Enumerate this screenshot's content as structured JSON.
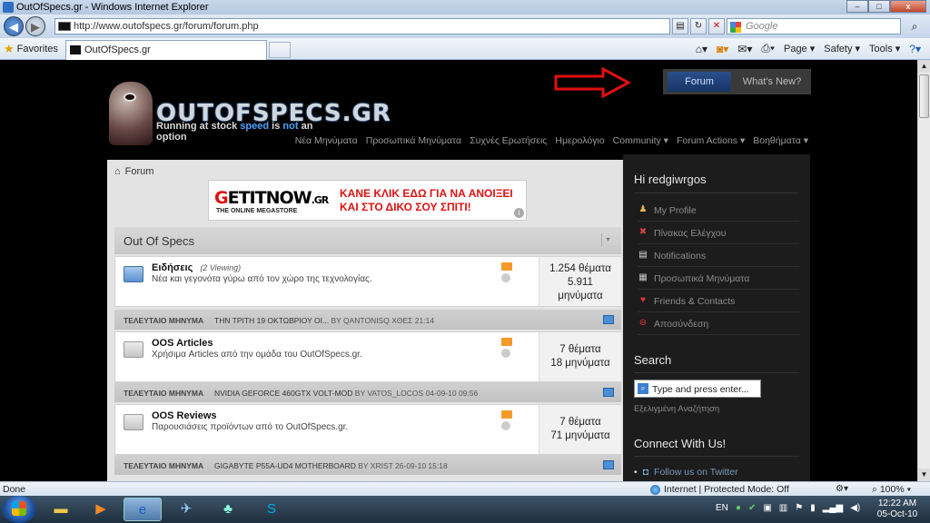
{
  "window": {
    "title": "OutOfSpecs.gr - Windows Internet Explorer",
    "min": "–",
    "max": "□",
    "close": "x"
  },
  "address": {
    "url": "http://www.outofspecs.gr/forum/forum.php",
    "search_placeholder": "Google"
  },
  "favorites": {
    "label": "Favorites",
    "tab_label": "OutOfSpecs.gr"
  },
  "commands": [
    "Page",
    "Safety",
    "Tools"
  ],
  "site": {
    "logo_name": "OUTOFSPECS.GR",
    "tagline_1": "Running at stock",
    "tagline_2": "speed",
    "tagline_3": "is",
    "tagline_4": "not",
    "tagline_5": "an option",
    "top_nav": {
      "forum": "Forum",
      "whats_new": "What's New?"
    },
    "sub_nav": [
      "Νέα Μηνύματα",
      "Προσωπικά Μηνύματα",
      "Συχνές Ερωτήσεις",
      "Ημερολόγιο",
      "Community ▾",
      "Forum Actions ▾",
      "Βοηθήματα ▾"
    ],
    "breadcrumb": "Forum"
  },
  "banner": {
    "brand_1": "G",
    "brand_2": "ETITNOW",
    "brand_3": ".GR",
    "sub": "THE ONLINE MEGASTORE",
    "msg_1": "ΚΑΝΕ ΚΛΙΚ ΕΔΩ ΓΙΑ ΝΑ ΑΝΟΙΞΕΙ",
    "msg_2": "ΚΑΙ ΣΤΟ ΔΙΚΟ ΣΟΥ ΣΠΙΤΙ!",
    "info": "i"
  },
  "category": {
    "title": "Out Of Specs",
    "collapse": "▾"
  },
  "forums": [
    {
      "name": "Ειδήσεις",
      "viewing": "(2 Viewing)",
      "desc": "Νέα και γεγονότα γύρω από τον χώρο της τεχνολογίας.",
      "stat_1": "1.254 θέματα",
      "stat_2": "5.911",
      "stat_3": "μηνύματα",
      "last_label": "ΤΕΛΕΥΤΑΙΟ ΜΗΝΥΜΑ",
      "last_title": "ΤΗΝ ΤΡΙΤΗ 19 ΟΚΤΩΒΡΙΟΥ ΟΙ...",
      "last_by": "BY QANTONISQ ΧΘΕΣ 21:14"
    },
    {
      "name": "OOS Articles",
      "viewing": "",
      "desc": "Χρήσιμα Articles από την ομάδα του OutOfSpecs.gr.",
      "stat_1": "7 θέματα",
      "stat_2": "18 μηνύματα",
      "stat_3": "",
      "last_label": "ΤΕΛΕΥΤΑΙΟ ΜΗΝΥΜΑ",
      "last_title": "NVIDIA GEFORCE 460GTX VOLT-MOD",
      "last_by": "BY VATOS_LOCOS 04-09-10 09:56"
    },
    {
      "name": "OOS Reviews",
      "viewing": "",
      "desc": "Παρουσιάσεις προϊόντων από το OutOfSpecs.gr.",
      "stat_1": "7 θέματα",
      "stat_2": "71 μηνύματα",
      "stat_3": "",
      "last_label": "ΤΕΛΕΥΤΑΙΟ ΜΗΝΥΜΑ",
      "last_title": "GIGABYTE P55A-UD4 MOTHERBOARD",
      "last_by": "BY XRIST 26-09-10 15:18"
    }
  ],
  "sidebar": {
    "greeting": "Hi redgiwrgos",
    "items": [
      "My Profile",
      "Πίνακας Ελέγχου",
      "Notifications",
      "Προσωπικά Μηνύματα",
      "Friends & Contacts",
      "Αποσύνδεση"
    ],
    "search_title": "Search",
    "search_placeholder": "Type and press enter...",
    "advanced": "Εξελιγμένη Αναζήτηση",
    "connect_title": "Connect With Us!",
    "follow": "Follow us on Twitter"
  },
  "status": {
    "left": "Done",
    "zone": "Internet | Protected Mode: Off",
    "zoom": "100%"
  },
  "taskbar": {
    "lang": "EN",
    "time": "12:22 AM",
    "date": "05-Oct-10"
  }
}
